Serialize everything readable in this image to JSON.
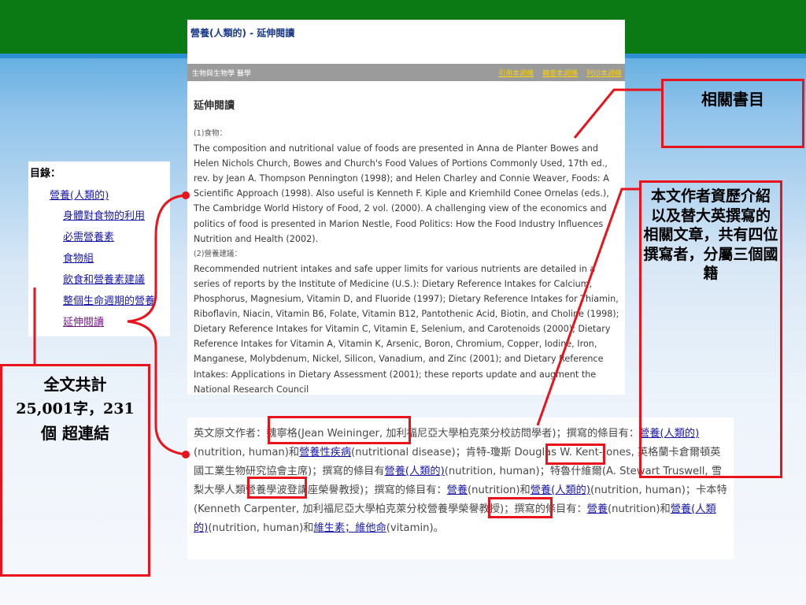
{
  "panel": {
    "title": "營養(人類的) - 延伸閱讀",
    "toolbar_crumb": "生物與生物學  醫學",
    "toolbar_links": [
      "引用本詞條",
      "轉寄本詞條",
      "列印本詞條"
    ],
    "section_heading": "延伸閱讀",
    "sub1": "(1)食物：",
    "para1": "The composition and nutritional value of foods are presented in Anna de Planter Bowes and Helen Nichols Church, Bowes and Church's Food Values of Portions Commonly Used, 17th ed., rev. by Jean A. Thompson Pennington (1998); and Helen Charley and Connie Weaver, Foods: A Scientific Approach (1998). Also useful is Kenneth F. Kiple and Kriemhild Conee Ornelas (eds.), The Cambridge World History of Food, 2 vol. (2000). A challenging view of the economics and politics of food is presented in Marion Nestle, Food Politics: How the Food Industry Influences Nutrition and Health (2002).",
    "sub2": "(2)營養建議：",
    "para2": "Recommended nutrient intakes and safe upper limits for various nutrients are detailed in a series of reports by the Institute of Medicine (U.S.): Dietary Reference Intakes for Calcium, Phosphorus, Magnesium, Vitamin D, and Fluoride (1997); Dietary Reference Intakes for Thiamin, Riboflavin, Niacin, Vitamin B6, Folate, Vitamin B12, Pantothenic Acid, Biotin, and Choline (1998); Dietary Reference Intakes for Vitamin C, Vitamin E, Selenium, and Carotenoids (2000); Dietary Reference Intakes for Vitamin A, Vitamin K, Arsenic, Boron, Chromium, Copper, Iodine, Iron, Manganese, Molybdenum, Nickel, Silicon, Vanadium, and Zinc (2001); and Dietary Reference Intakes: Applications in Dietary Assessment (2001); these reports update and augment the National Research Council"
  },
  "toc": {
    "label": "目錄：",
    "root": "營養(人類的)",
    "items": [
      "身體對食物的利用",
      "必需營養素",
      "食物組",
      "飲食和營養素建議",
      "整個生命週期的營養",
      "延伸閱讀"
    ]
  },
  "attr": {
    "t1": "英文原文作者：",
    "name1": "魏寧格(Jean Weininger, ",
    "t2": "加利福尼亞大學柏克萊分校訪問學者)；撰寫的條目有：",
    "l1": "營養(人類的)",
    "t3": "(nutrition, human)和",
    "l2": "營養性疾病",
    "t4": "(nutritional disease)；",
    "name2": "肯特-瓊斯",
    "t5": " Douglas W. Kent-Jones, 英格蘭卡倉爾頓英國工業生物研究協會主席)；撰寫的條目有",
    "l3": "營養(人類的)",
    "t6": "(nutrition, human)；",
    "name3": "特魯什維爾",
    "t7": "(A. Stewart Truswell, 雪梨大學人類營養學波登講座榮譽教授)；撰寫的條目有：",
    "l4": "營養",
    "t8": "(nutrition)和",
    "l5": "營養(人類的)",
    "t9": "(nutrition, human)；",
    "name4": "卡本特",
    "t10": "(Kenneth Carpenter, 加利福尼亞大學柏克萊分校營養學榮譽教授)；撰寫的條目有：",
    "l6": "營養",
    "t11": "(nutrition)和",
    "l7": "營養(人類的)",
    "t12": "(nutrition, human)和",
    "l8": "維生素；維他命",
    "t13": "(vitamin)。"
  },
  "callouts": {
    "books": "相關書目",
    "authors": "本文作者資歷介紹\n以及替大英撰寫的\n相關文章，共有四位撰寫者，分屬三個國籍",
    "fulltext_line1": "全文共計",
    "fulltext_line2": "25,001字，231",
    "fulltext_line3": "個 超連結"
  },
  "colors": {
    "annotation_red": "#e8131b",
    "header_green": "#0b7a14",
    "link_blue": "#1a1aa8",
    "toolbar_link_yellow": "#ffd200"
  }
}
